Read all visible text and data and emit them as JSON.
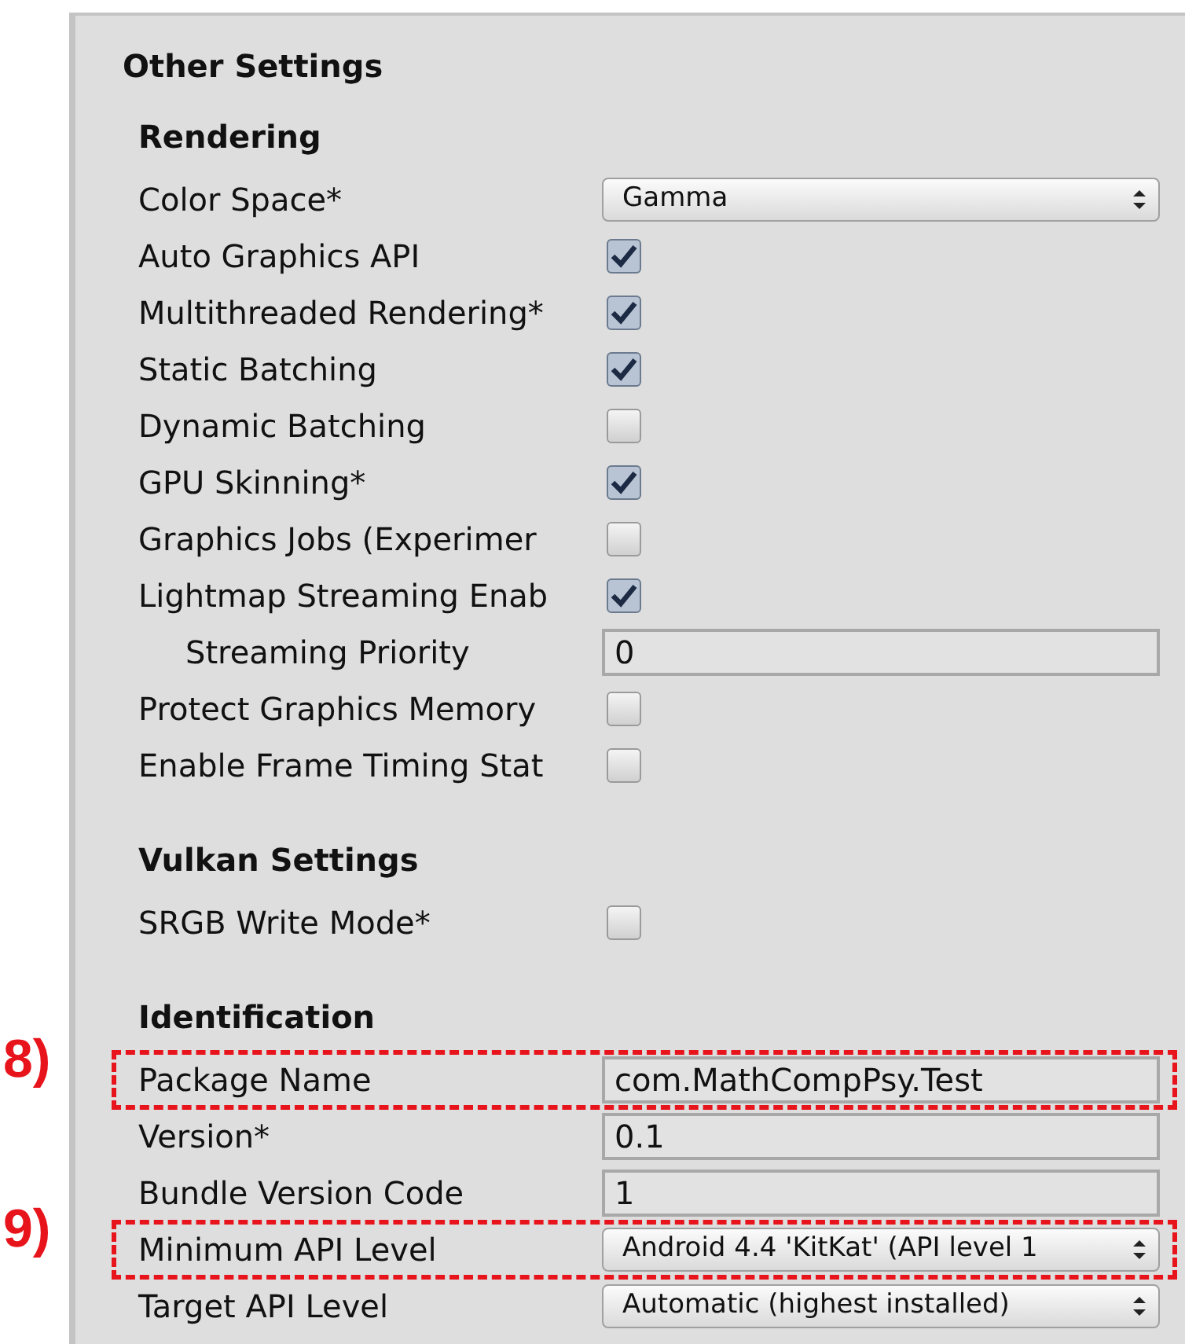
{
  "panel": {
    "title": "Other Settings",
    "sections": [
      {
        "title": "Rendering",
        "rows": [
          {
            "kind": "dropdown",
            "label": "Color Space*",
            "value": "Gamma"
          },
          {
            "kind": "checkbox",
            "label": "Auto Graphics API",
            "checked": true
          },
          {
            "kind": "checkbox",
            "label": "Multithreaded Rendering*",
            "checked": true
          },
          {
            "kind": "checkbox",
            "label": "Static Batching",
            "checked": true
          },
          {
            "kind": "checkbox",
            "label": "Dynamic Batching",
            "checked": false
          },
          {
            "kind": "checkbox",
            "label": "GPU Skinning*",
            "checked": true
          },
          {
            "kind": "checkbox",
            "label": "Graphics Jobs (Experimer",
            "checked": false
          },
          {
            "kind": "checkbox",
            "label": "Lightmap Streaming Enab",
            "checked": true,
            "children": [
              {
                "kind": "text",
                "label": "Streaming Priority",
                "value": "0"
              }
            ]
          },
          {
            "kind": "checkbox",
            "label": "Protect Graphics Memory",
            "checked": false
          },
          {
            "kind": "checkbox",
            "label": "Enable Frame Timing Stat",
            "checked": false
          }
        ]
      },
      {
        "title": "Vulkan Settings",
        "rows": [
          {
            "kind": "checkbox",
            "label": "SRGB Write Mode*",
            "checked": false
          }
        ]
      },
      {
        "title": "Identification",
        "rows": [
          {
            "kind": "text",
            "label": "Package Name",
            "value": "com.MathCompPsy.Test",
            "callout": "8)"
          },
          {
            "kind": "text",
            "label": "Version*",
            "value": "0.1"
          },
          {
            "kind": "text",
            "label": "Bundle Version Code",
            "value": "1"
          },
          {
            "kind": "dropdown",
            "label": "Minimum API Level",
            "value": "Android 4.4 'KitKat' (API level 1",
            "callout": "9)"
          },
          {
            "kind": "dropdown",
            "label": "Target API Level",
            "value": "Automatic (highest installed)"
          }
        ]
      }
    ]
  }
}
